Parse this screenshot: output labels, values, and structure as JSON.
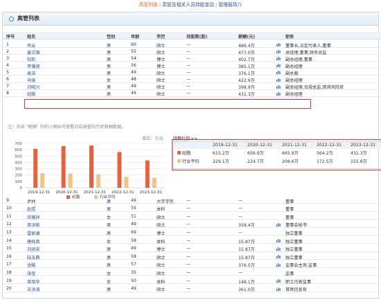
{
  "nav": {
    "active": "高管列表",
    "link1": "高管及相关人员持股变动",
    "link2": "管理层简介",
    "sep": "|"
  },
  "panel_title": "高管列表",
  "columns": [
    "序号",
    "姓名",
    "性别",
    "年龄",
    "学历",
    "持股数(股)",
    "薪酬(元)",
    "职务"
  ],
  "rows_top": [
    {
      "no": "1",
      "name": "冉云",
      "sex": "男",
      "age": "60",
      "edu": "硕士",
      "shares": "—",
      "pay": "486.4万",
      "title": "董事长,法定代表人,董事"
    },
    {
      "no": "2",
      "name": "姜文国",
      "sex": "男",
      "age": "55",
      "edu": "硕士",
      "shares": "—",
      "pay": "477.0万",
      "title": "总经理,董事,财务总监"
    },
    {
      "no": "3",
      "name": "杜航",
      "sex": "男",
      "age": "54",
      "edu": "博士",
      "shares": "—",
      "pay": "402.7万",
      "title": "副总经理,董事"
    },
    {
      "no": "4",
      "name": "李蒲贤",
      "sex": "男",
      "age": "56",
      "edu": "博士",
      "shares": "—",
      "pay": "385.1万",
      "title": "副总经理"
    },
    {
      "no": "5",
      "name": "易浩",
      "sex": "男",
      "age": "49",
      "edu": "硕士",
      "shares": "—",
      "pay": "376.1万",
      "title": "副总裁"
    },
    {
      "no": "6",
      "name": "马骏",
      "sex": "女",
      "age": "48",
      "edu": "硕士",
      "shares": "—",
      "pay": "422.9万",
      "title": "副总经理"
    },
    {
      "no": "7",
      "name": "刘昭兴",
      "sex": "男",
      "age": "49",
      "edu": "硕士",
      "shares": "—",
      "pay": "398.9万",
      "title": "副总经理,合规总监,首席风险官"
    },
    {
      "no": "8",
      "name": "纪路",
      "sex": "男",
      "age": "49",
      "edu": "硕士",
      "shares": "—",
      "pay": "431.3万",
      "title": "副总经理"
    }
  ],
  "note": "注：点击 \"薪酬\" 列的小图标可查看对应高管的历史薪酬数据。",
  "unit": "单位：万元",
  "compare_title": "同期比较>>",
  "compare": {
    "years": [
      "2019-12-31",
      "2020-12-31",
      "2021-12-31",
      "2022-12-31",
      "2023-12-31"
    ],
    "rows": [
      {
        "label": "纪路",
        "color": "#e8603c",
        "values": [
          "615.2万",
          "656.9万",
          "665.9万",
          "564.2万",
          "431.3万"
        ]
      },
      {
        "label": "行业平均",
        "color": "#f3c483",
        "values": [
          "229.1万",
          "224.7万",
          "208.6万",
          "172.5万",
          "155.8万"
        ]
      }
    ]
  },
  "chart_data": {
    "type": "bar",
    "categories": [
      "2019-12-31",
      "2020-12-31",
      "2021-12-31",
      "2022-12-31",
      "2023-12-31"
    ],
    "series": [
      {
        "name": "纪路",
        "color": "#e8603c",
        "values": [
          615.2,
          656.9,
          665.9,
          564.2,
          431.3
        ]
      },
      {
        "name": "行业平均",
        "color": "#f3c483",
        "values": [
          229.1,
          224.7,
          208.6,
          172.5,
          155.8
        ]
      }
    ],
    "yticks": [
      "0",
      "100",
      "200",
      "300",
      "400",
      "500",
      "600",
      "700"
    ],
    "ylim": [
      0,
      700
    ],
    "grid": true,
    "legend": "bottom"
  },
  "rows_bottom": [
    {
      "no": "9",
      "name": "尹林",
      "sex": "男",
      "age": "49",
      "edu": "大学学历",
      "shares": "—",
      "pay": "—",
      "title": "董事",
      "icon": false
    },
    {
      "no": "10",
      "name": "赵煜",
      "sex": "男",
      "age": "55",
      "edu": "本科",
      "shares": "—",
      "pay": "—",
      "title": "董事",
      "icon": false
    },
    {
      "no": "11",
      "name": "邓薇祥",
      "sex": "女",
      "age": "51",
      "edu": "硕士",
      "shares": "—",
      "pay": "—",
      "title": "董事",
      "icon": false
    },
    {
      "no": "12",
      "name": "周洪刚",
      "sex": "男",
      "age": "49",
      "edu": "硕士",
      "shares": "—",
      "pay": "358.4万",
      "title": "董事会秘书",
      "icon": true
    },
    {
      "no": "13",
      "name": "雷家骕",
      "sex": "男",
      "age": "69",
      "edu": "博士",
      "shares": "—",
      "pay": "—",
      "title": "独立董事",
      "icon": false
    },
    {
      "no": "14",
      "name": "唐秋英",
      "sex": "女",
      "age": "58",
      "edu": "本科",
      "shares": "—",
      "pay": "15.87万",
      "title": "独立董事",
      "icon": true
    },
    {
      "no": "15",
      "name": "刘运宏",
      "sex": "男",
      "age": "49",
      "edu": "博士",
      "shares": "—",
      "pay": "15.87万",
      "title": "独立董事",
      "icon": true
    },
    {
      "no": "16",
      "name": "陆玉鼎",
      "sex": "男",
      "age": "58",
      "edu": "硕士",
      "shares": "—",
      "pay": "15.87万",
      "title": "独立董事",
      "icon": true
    },
    {
      "no": "17",
      "name": "金鹏",
      "sex": "男",
      "age": "57",
      "edu": "硕士",
      "shares": "—",
      "pay": "376.5万",
      "title": "监事会主席,监事",
      "icon": true
    },
    {
      "no": "18",
      "name": "张莹",
      "sex": "女",
      "age": "35",
      "edu": "硕士",
      "shares": "—",
      "pay": "—",
      "title": "监事",
      "icon": false
    },
    {
      "no": "19",
      "name": "苗伟华",
      "sex": "女",
      "age": "50",
      "edu": "本科",
      "shares": "—",
      "pay": "148.1万",
      "title": "职工代表监事",
      "icon": true
    },
    {
      "no": "20",
      "name": "王洪涛",
      "sex": "男",
      "age": "49",
      "edu": "硕士",
      "shares": "—",
      "pay": "361.0万",
      "title": "首席信息官",
      "icon": true
    }
  ]
}
